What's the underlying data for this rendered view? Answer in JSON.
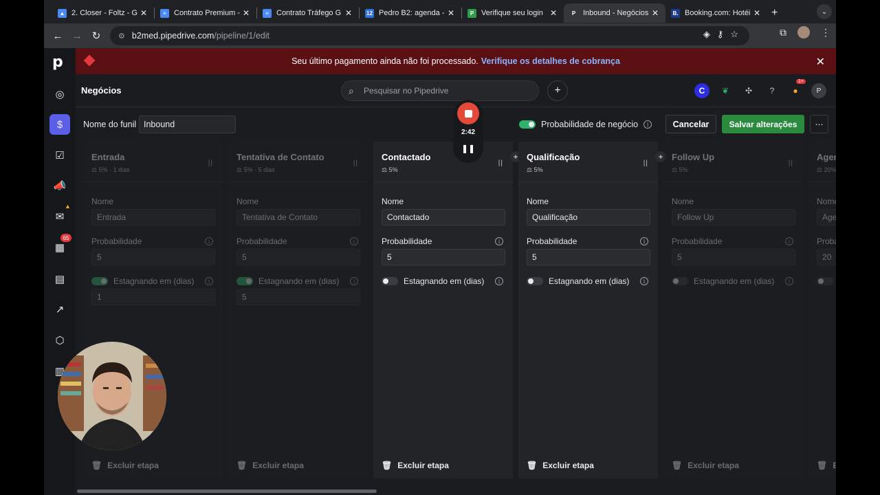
{
  "browser": {
    "tabs": [
      {
        "label": "2. Closer - Foltz - G",
        "icon": "drive-icon",
        "color": "#4a8af4",
        "glyph": "▲"
      },
      {
        "label": "Contrato Premium -",
        "icon": "docs-icon",
        "color": "#4a8af4",
        "glyph": "≡"
      },
      {
        "label": "Contrato Tráfego G",
        "icon": "docs-icon",
        "color": "#4a8af4",
        "glyph": "≡"
      },
      {
        "label": "Pedro B2: agenda -",
        "icon": "calendar-icon",
        "color": "#2e6fd8",
        "glyph": "12"
      },
      {
        "label": "Verifique seu login",
        "icon": "pipedrive-icon",
        "color": "#2f9c4b",
        "glyph": "P"
      },
      {
        "label": "Inbound - Negócios",
        "icon": "pipedrive-icon",
        "color": "#35363a",
        "glyph": "P"
      },
      {
        "label": "Booking.com: Hotéi",
        "icon": "booking-icon",
        "color": "#1e3a8a",
        "glyph": "B."
      }
    ],
    "active_tab": 5,
    "url_host": "b2med.pipedrive.com",
    "url_path": "/pipeline/1/edit"
  },
  "app": {
    "logo": "p",
    "banner": {
      "text": "Seu último pagamento ainda não foi processado.",
      "link": "Verifique os detalhes de cobrança"
    },
    "page_title": "Negócios",
    "search_placeholder": "Pesquisar no Pipedrive",
    "notification_badge": "1+",
    "avatar": "P",
    "top_c": "C",
    "sidebar_badge": "65",
    "funnel": {
      "label": "Nome do funil",
      "value": "Inbound",
      "probability_label": "Probabilidade de negócio",
      "probability_on": true,
      "cancel": "Cancelar",
      "save": "Salvar alterações"
    },
    "stage_labels": {
      "name": "Nome",
      "probability": "Probabilidade",
      "rotting": "Estagnando em (dias)",
      "delete": "Excluir etapa"
    },
    "stages": [
      {
        "title": "Entrada",
        "meta": "5%  ·  1 dias",
        "name": "Entrada",
        "probability": "5",
        "rotting_on": true,
        "rotting_days": "1",
        "active": false
      },
      {
        "title": "Tentativa de Contato",
        "meta": "5%  ·  5 dias",
        "name": "Tentativa de Contato",
        "probability": "5",
        "rotting_on": true,
        "rotting_days": "5",
        "active": false
      },
      {
        "title": "Contactado",
        "meta": "5%",
        "name": "Contactado",
        "probability": "5",
        "rotting_on": false,
        "rotting_days": "",
        "active": true
      },
      {
        "title": "Qualificação",
        "meta": "5%",
        "name": "Qualificação",
        "probability": "5",
        "rotting_on": false,
        "rotting_days": "",
        "active": true
      },
      {
        "title": "Follow Up",
        "meta": "5%",
        "name": "Follow Up",
        "probability": "5",
        "rotting_on": false,
        "rotting_days": "",
        "active": false
      },
      {
        "title": "Agendamento",
        "meta": "20%",
        "name": "Agendamento",
        "probability": "20",
        "rotting_on": false,
        "rotting_days": "",
        "active": false
      }
    ]
  },
  "recorder": {
    "time": "2:42"
  }
}
